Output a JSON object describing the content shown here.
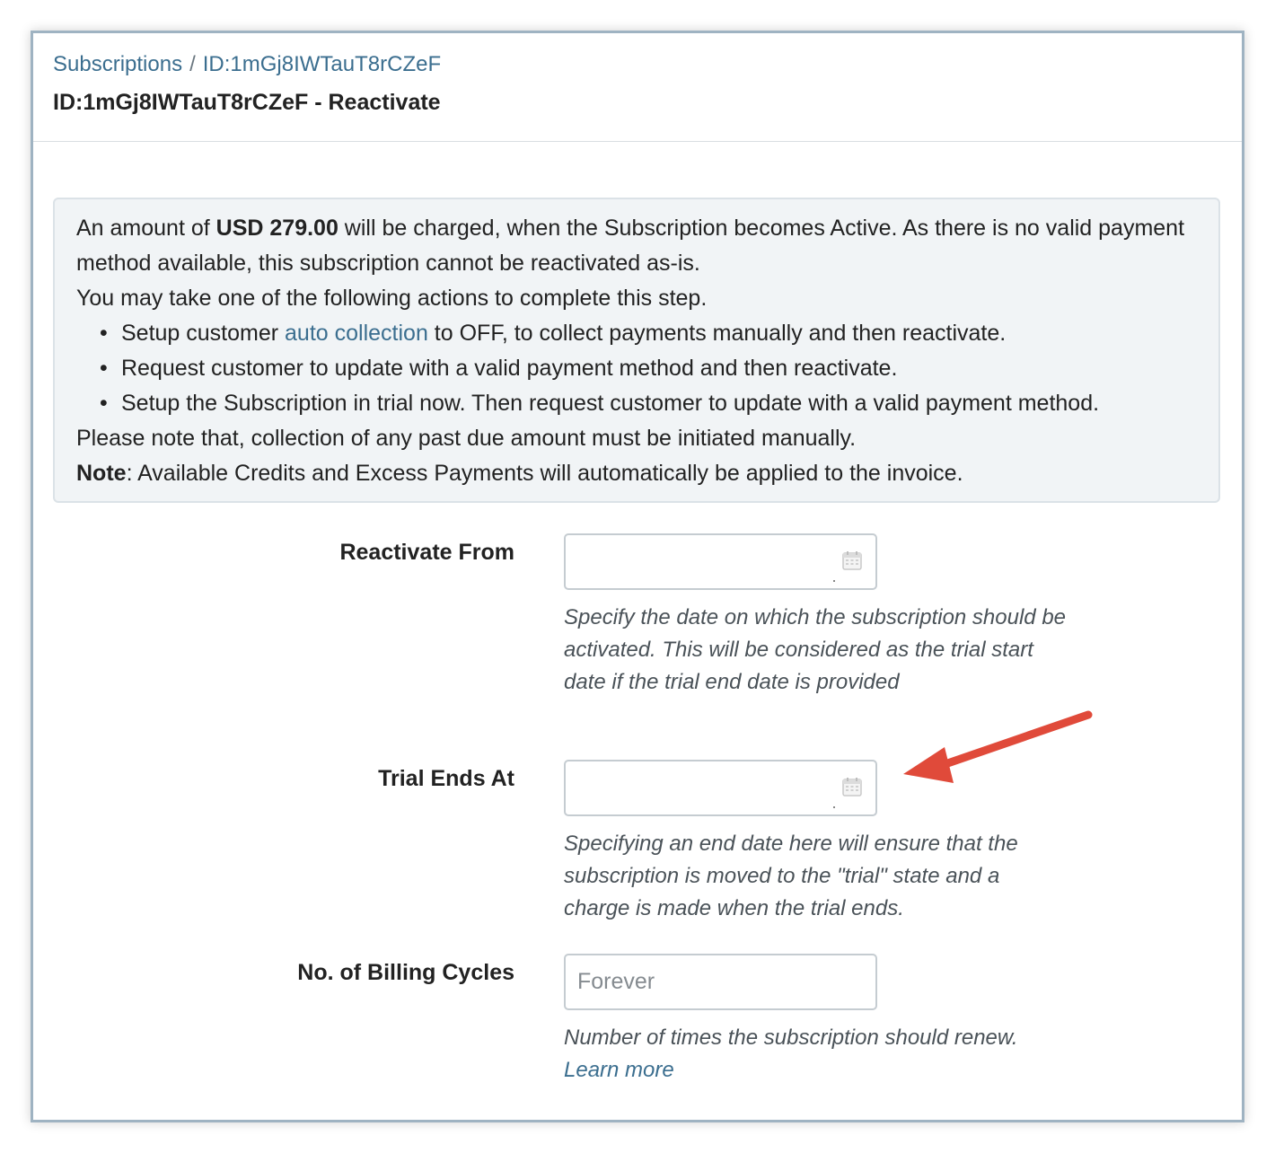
{
  "breadcrumb": {
    "root": "Subscriptions",
    "separator": "/",
    "current": "ID:1mGj8IWTauT8rCZeF"
  },
  "page_title": "ID:1mGj8IWTauT8rCZeF - Reactivate",
  "notice": {
    "line1_prefix": "An amount of ",
    "amount": "USD 279.00",
    "line1_suffix": " will be charged, when the Subscription becomes Active. As there is no valid payment method available, this subscription cannot be reactivated as-is.",
    "line2": "You may take one of the following actions to complete this step.",
    "bullets": [
      {
        "prefix": "Setup customer ",
        "link": "auto collection",
        "suffix": " to OFF, to collect payments manually and then reactivate."
      },
      {
        "text": "Request customer to update with a valid payment method and then reactivate."
      },
      {
        "text": "Setup the Subscription in trial now. Then request customer to update with a valid payment method."
      }
    ],
    "line3": "Please note that, collection of any past due amount must be initiated manually.",
    "note_label": "Note",
    "note_text": ": Available Credits and Excess Payments will automatically be applied to the invoice."
  },
  "fields": {
    "reactivate_from": {
      "label": "Reactivate From",
      "value": "",
      "help": "Specify the date on which the subscription should be activated. This will be considered as the trial start date if the trial end date is provided"
    },
    "trial_ends_at": {
      "label": "Trial Ends At",
      "value": "",
      "help": "Specifying an end date here will ensure that the subscription is moved to the \"trial\" state and a charge is made when the trial ends."
    },
    "billing_cycles": {
      "label": "No. of Billing Cycles",
      "placeholder": "Forever",
      "help_prefix": "Number of times the subscription should renew. ",
      "help_link": "Learn more"
    }
  },
  "icons": {
    "date_picker": "calendar-icon",
    "annotation": "red-arrow-icon"
  },
  "colors": {
    "link": "#3b6e8f",
    "notice_bg": "#f1f4f6",
    "arrow": "#e04a3a",
    "frame_border": "#9fb3c2"
  }
}
